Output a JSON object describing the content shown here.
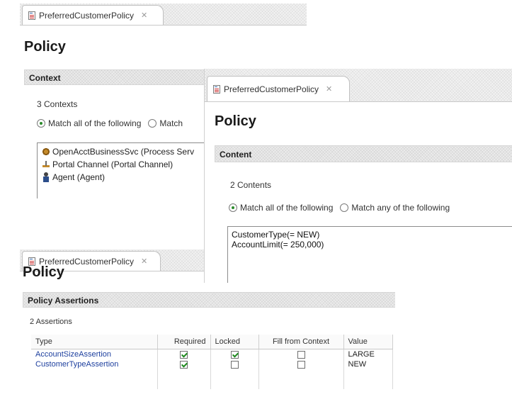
{
  "editors": [
    {
      "tab_label": "PreferredCustomerPolicy",
      "title": "Policy",
      "section": "Context",
      "count": "3 Contexts",
      "match_all": "Match all of the following",
      "match_any_partial": "Match",
      "items": [
        {
          "label": "OpenAcctBusinessSvc (Process Serv",
          "icon": "service-icon"
        },
        {
          "label": "Portal Channel (Portal Channel)",
          "icon": "portal-channel-icon"
        },
        {
          "label": "Agent (Agent)",
          "icon": "agent-icon"
        }
      ]
    },
    {
      "tab_label": "PreferredCustomerPolicy",
      "title": "Policy",
      "section": "Content",
      "count": "2 Contents",
      "match_all": "Match all of the following",
      "match_any": "Match any of the following",
      "lines": [
        "CustomerType(= NEW)",
        "AccountLimit(= 250,000)"
      ]
    },
    {
      "tab_label": "PreferredCustomerPolicy",
      "title": "Policy",
      "section": "Policy Assertions",
      "count": "2 Assertions",
      "columns": [
        "Type",
        "Required",
        "Locked",
        "Fill from Context",
        "Value"
      ],
      "rows": [
        {
          "type": "AccountSizeAssertion",
          "required": true,
          "locked": true,
          "fill_from_context": false,
          "value": "LARGE"
        },
        {
          "type": "CustomerTypeAssertion",
          "required": true,
          "locked": false,
          "fill_from_context": false,
          "value": "NEW"
        }
      ]
    }
  ]
}
